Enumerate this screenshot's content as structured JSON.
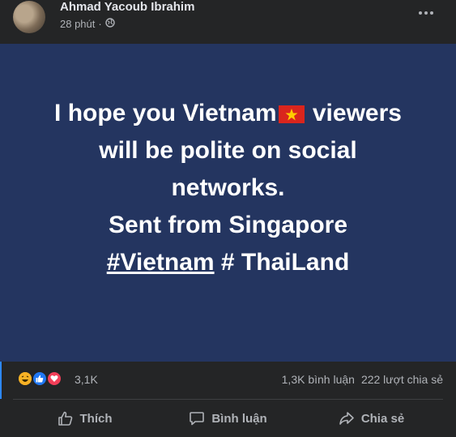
{
  "post": {
    "author": "Ahmad Yacoub Ibrahim",
    "time": "28 phút",
    "separator": "·",
    "privacy_icon": "globe-icon",
    "more_icon": "more-options-icon",
    "body": {
      "line1_before_flag": "I hope you Vietnam",
      "flag_icon": "vietnam-flag-icon",
      "line1_after_flag": " viewers",
      "line2": "will be polite on social",
      "line3": "networks.",
      "line4": "Sent from Singapore",
      "hashtag": "#Vietnam",
      "line5_rest": " # ThaiLand",
      "background_color": "#243560"
    }
  },
  "reactions": {
    "icons": [
      "haha-reaction-icon",
      "like-reaction-icon",
      "love-reaction-icon"
    ],
    "count": "3,1K",
    "comments": "1,3K bình luận",
    "shares": "222 lượt chia sẻ"
  },
  "actions": {
    "like": "Thích",
    "comment": "Bình luận",
    "share": "Chia sẻ"
  },
  "colors": {
    "card": "#242526",
    "text_primary": "#e4e6eb",
    "text_secondary": "#b0b3b8",
    "accent": "#2d88ff"
  }
}
